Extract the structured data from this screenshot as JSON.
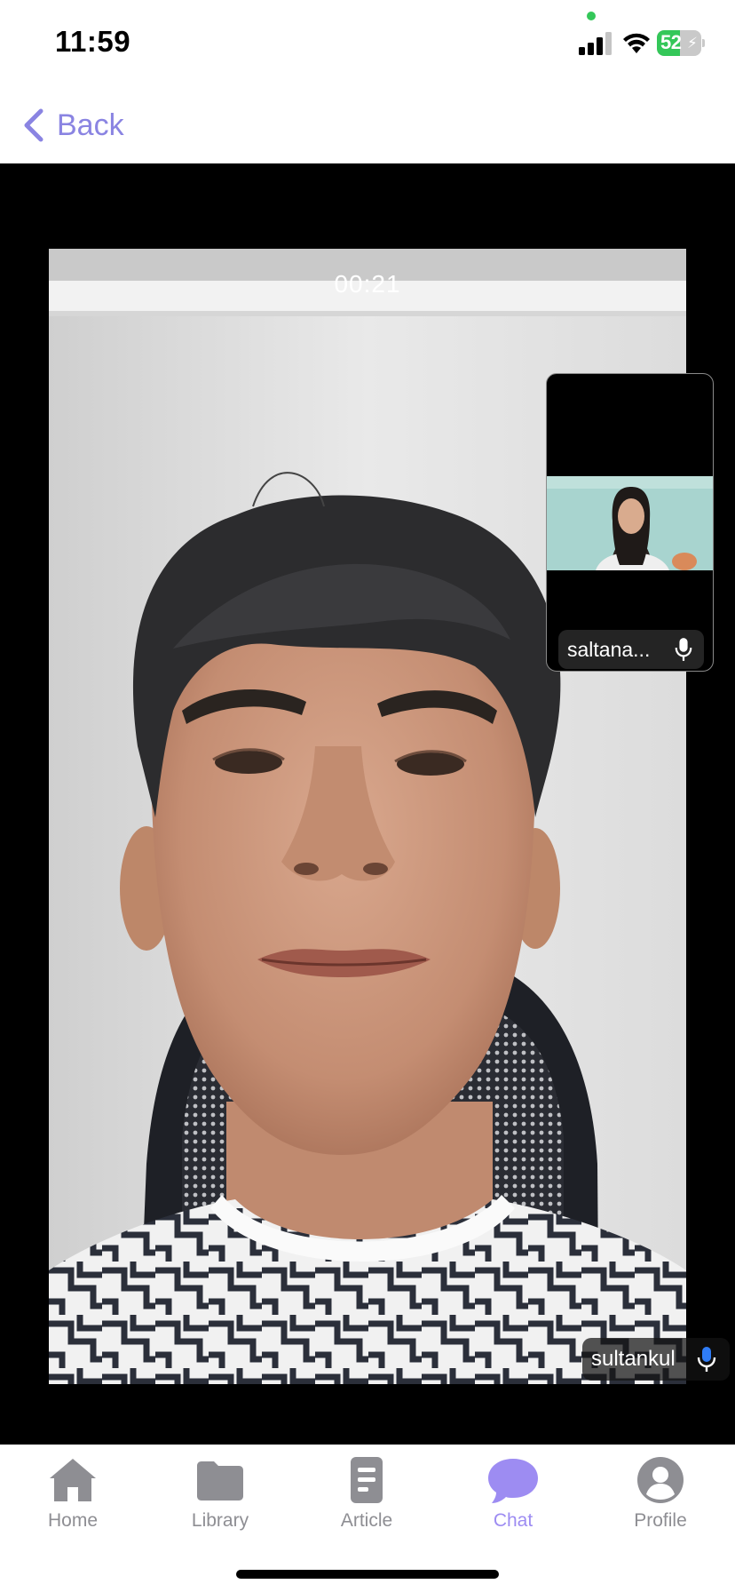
{
  "status_bar": {
    "time": "11:59",
    "battery_percent": "52",
    "battery_level": 0.52,
    "battery_color": "#34c759",
    "privacy_dot_color": "#34c759",
    "charging_icon": "bolt-icon"
  },
  "nav": {
    "back_label": "Back",
    "accent_color": "#8a84e2"
  },
  "call": {
    "timer": "00:21",
    "remote_participant": {
      "name": "sultankul",
      "mic_icon": "microphone-icon",
      "mic_accent": "#2f7cf6"
    },
    "local_preview": {
      "name": "saltana...",
      "mic_icon": "microphone-icon"
    }
  },
  "tab_bar": {
    "active_color": "#9d8cf2",
    "inactive_color": "#8e8e93",
    "tabs": [
      {
        "label": "Home",
        "icon": "home-icon",
        "active": false
      },
      {
        "label": "Library",
        "icon": "folder-icon",
        "active": false
      },
      {
        "label": "Article",
        "icon": "article-icon",
        "active": false
      },
      {
        "label": "Chat",
        "icon": "chat-bubble-icon",
        "active": true
      },
      {
        "label": "Profile",
        "icon": "person-icon",
        "active": false
      }
    ]
  }
}
